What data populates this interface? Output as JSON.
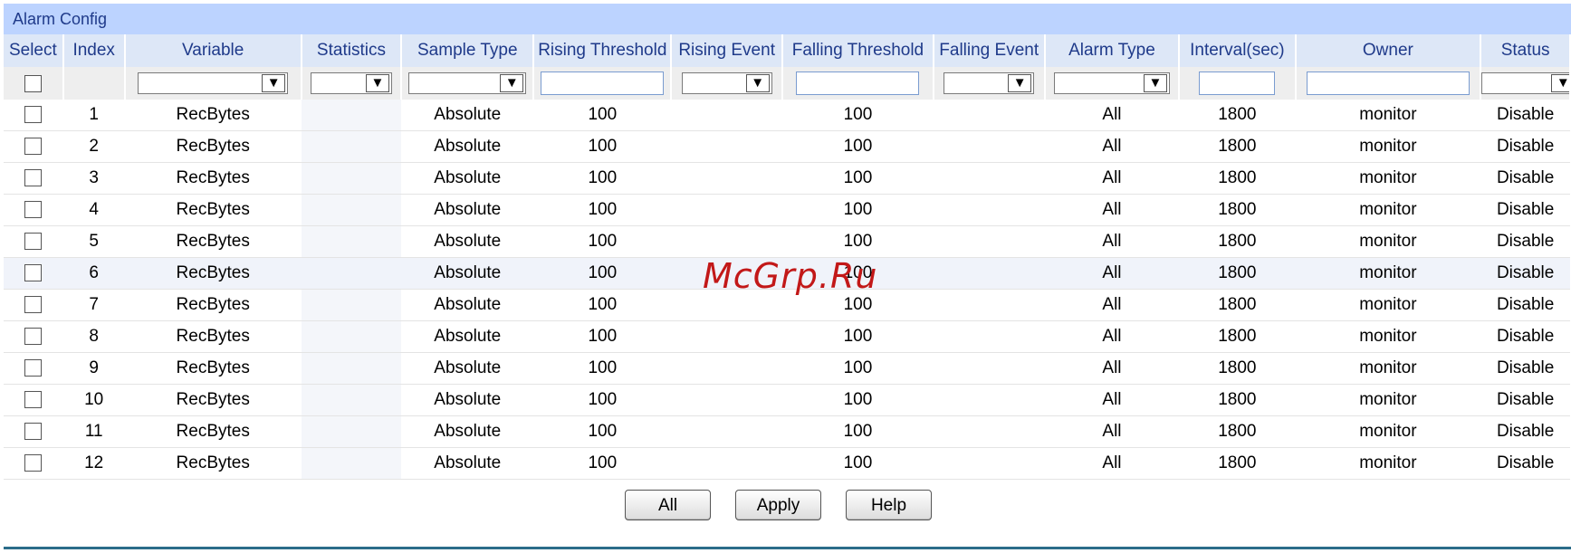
{
  "panel": {
    "title": "Alarm Config"
  },
  "columns": [
    "Select",
    "Index",
    "Variable",
    "Statistics",
    "Sample Type",
    "Rising Threshold",
    "Rising Event",
    "Falling Threshold",
    "Falling Event",
    "Alarm Type",
    "Interval(sec)",
    "Owner",
    "Status"
  ],
  "rows": [
    {
      "index": "1",
      "variable": "RecBytes",
      "statistics": "",
      "sample_type": "Absolute",
      "rising_threshold": "100",
      "rising_event": "",
      "falling_threshold": "100",
      "falling_event": "",
      "alarm_type": "All",
      "interval": "1800",
      "owner": "monitor",
      "status": "Disable"
    },
    {
      "index": "2",
      "variable": "RecBytes",
      "statistics": "",
      "sample_type": "Absolute",
      "rising_threshold": "100",
      "rising_event": "",
      "falling_threshold": "100",
      "falling_event": "",
      "alarm_type": "All",
      "interval": "1800",
      "owner": "monitor",
      "status": "Disable"
    },
    {
      "index": "3",
      "variable": "RecBytes",
      "statistics": "",
      "sample_type": "Absolute",
      "rising_threshold": "100",
      "rising_event": "",
      "falling_threshold": "100",
      "falling_event": "",
      "alarm_type": "All",
      "interval": "1800",
      "owner": "monitor",
      "status": "Disable"
    },
    {
      "index": "4",
      "variable": "RecBytes",
      "statistics": "",
      "sample_type": "Absolute",
      "rising_threshold": "100",
      "rising_event": "",
      "falling_threshold": "100",
      "falling_event": "",
      "alarm_type": "All",
      "interval": "1800",
      "owner": "monitor",
      "status": "Disable"
    },
    {
      "index": "5",
      "variable": "RecBytes",
      "statistics": "",
      "sample_type": "Absolute",
      "rising_threshold": "100",
      "rising_event": "",
      "falling_threshold": "100",
      "falling_event": "",
      "alarm_type": "All",
      "interval": "1800",
      "owner": "monitor",
      "status": "Disable"
    },
    {
      "index": "6",
      "variable": "RecBytes",
      "statistics": "",
      "sample_type": "Absolute",
      "rising_threshold": "100",
      "rising_event": "",
      "falling_threshold": "100",
      "falling_event": "",
      "alarm_type": "All",
      "interval": "1800",
      "owner": "monitor",
      "status": "Disable"
    },
    {
      "index": "7",
      "variable": "RecBytes",
      "statistics": "",
      "sample_type": "Absolute",
      "rising_threshold": "100",
      "rising_event": "",
      "falling_threshold": "100",
      "falling_event": "",
      "alarm_type": "All",
      "interval": "1800",
      "owner": "monitor",
      "status": "Disable"
    },
    {
      "index": "8",
      "variable": "RecBytes",
      "statistics": "",
      "sample_type": "Absolute",
      "rising_threshold": "100",
      "rising_event": "",
      "falling_threshold": "100",
      "falling_event": "",
      "alarm_type": "All",
      "interval": "1800",
      "owner": "monitor",
      "status": "Disable"
    },
    {
      "index": "9",
      "variable": "RecBytes",
      "statistics": "",
      "sample_type": "Absolute",
      "rising_threshold": "100",
      "rising_event": "",
      "falling_threshold": "100",
      "falling_event": "",
      "alarm_type": "All",
      "interval": "1800",
      "owner": "monitor",
      "status": "Disable"
    },
    {
      "index": "10",
      "variable": "RecBytes",
      "statistics": "",
      "sample_type": "Absolute",
      "rising_threshold": "100",
      "rising_event": "",
      "falling_threshold": "100",
      "falling_event": "",
      "alarm_type": "All",
      "interval": "1800",
      "owner": "monitor",
      "status": "Disable"
    },
    {
      "index": "11",
      "variable": "RecBytes",
      "statistics": "",
      "sample_type": "Absolute",
      "rising_threshold": "100",
      "rising_event": "",
      "falling_threshold": "100",
      "falling_event": "",
      "alarm_type": "All",
      "interval": "1800",
      "owner": "monitor",
      "status": "Disable"
    },
    {
      "index": "12",
      "variable": "RecBytes",
      "statistics": "",
      "sample_type": "Absolute",
      "rising_threshold": "100",
      "rising_event": "",
      "falling_threshold": "100",
      "falling_event": "",
      "alarm_type": "All",
      "interval": "1800",
      "owner": "monitor",
      "status": "Disable"
    }
  ],
  "buttons": {
    "all": "All",
    "apply": "Apply",
    "help": "Help"
  },
  "watermark": "McGrp.Ru",
  "icons": {
    "dropdown": "chevron-down-icon"
  },
  "colors": {
    "title_bar": "#bcd3ff",
    "title_text": "#1f3a8a",
    "bottom_rule": "#2b6d8a"
  }
}
